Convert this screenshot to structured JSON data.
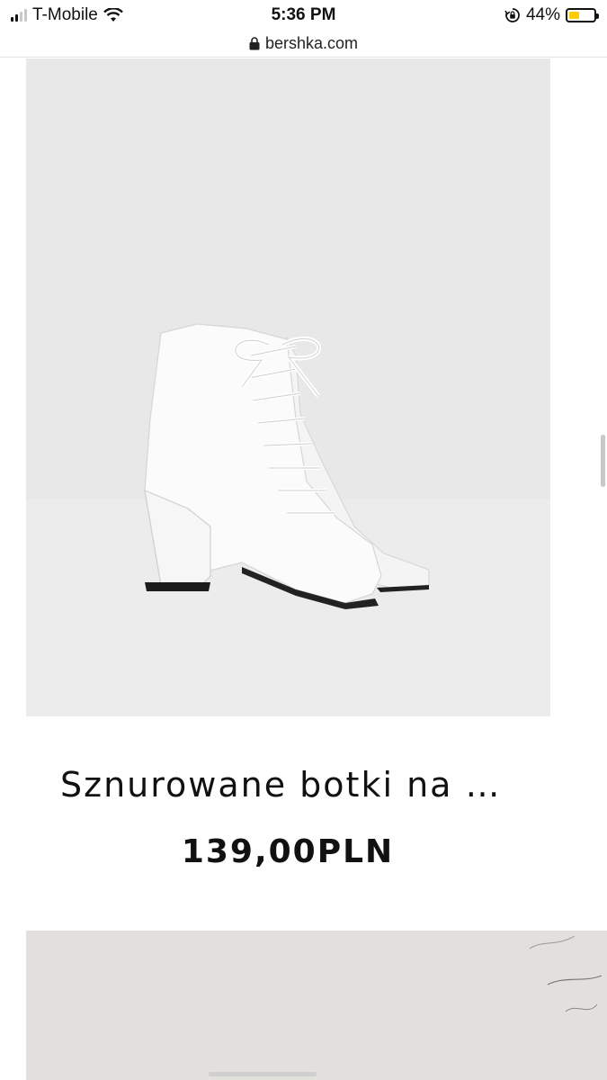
{
  "status_bar": {
    "carrier": "T-Mobile",
    "time": "5:36 PM",
    "battery_percent": "44%",
    "battery_level": 0.44,
    "signal_bars_active": 2,
    "signal_bars_total": 4,
    "icons": [
      "signal-icon",
      "wifi-icon",
      "rotation-lock-icon",
      "battery-icon"
    ]
  },
  "browser": {
    "url": "bershka.com",
    "secure_icon": "lock-icon"
  },
  "product": {
    "title": "Sznurowane botki na …",
    "price": "139,00PLN",
    "image_description_colors": {
      "background": "#e8e8e8",
      "boot": "#fafafa"
    }
  }
}
